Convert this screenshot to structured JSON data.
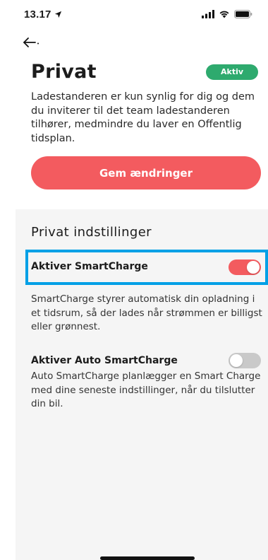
{
  "status_bar": {
    "time": "13.17"
  },
  "header": {
    "title": "Privat",
    "badge": "Aktiv"
  },
  "description": "Ladestanderen er kun synlig for dig og dem du inviterer til det team ladestanderen tilhører, medmindre du laver en Offentlig tidsplan.",
  "save_button": "Gem ændringer",
  "settings": {
    "title": "Privat indstillinger",
    "smartcharge": {
      "label": "Aktiver SmartCharge",
      "enabled": true,
      "description": "SmartCharge styrer automatisk din opladning i et tidsrum, så der lades når strømmen er billigst eller grønnest."
    },
    "auto_smartcharge": {
      "label": "Aktiver Auto SmartCharge",
      "enabled": false,
      "description": "Auto SmartCharge planlægger en Smart Charge med dine seneste indstillinger, når du tilslutter din bil."
    }
  },
  "colors": {
    "accent": "#f35b5f",
    "badge": "#2eaa6e",
    "highlight": "#00a0e6"
  }
}
